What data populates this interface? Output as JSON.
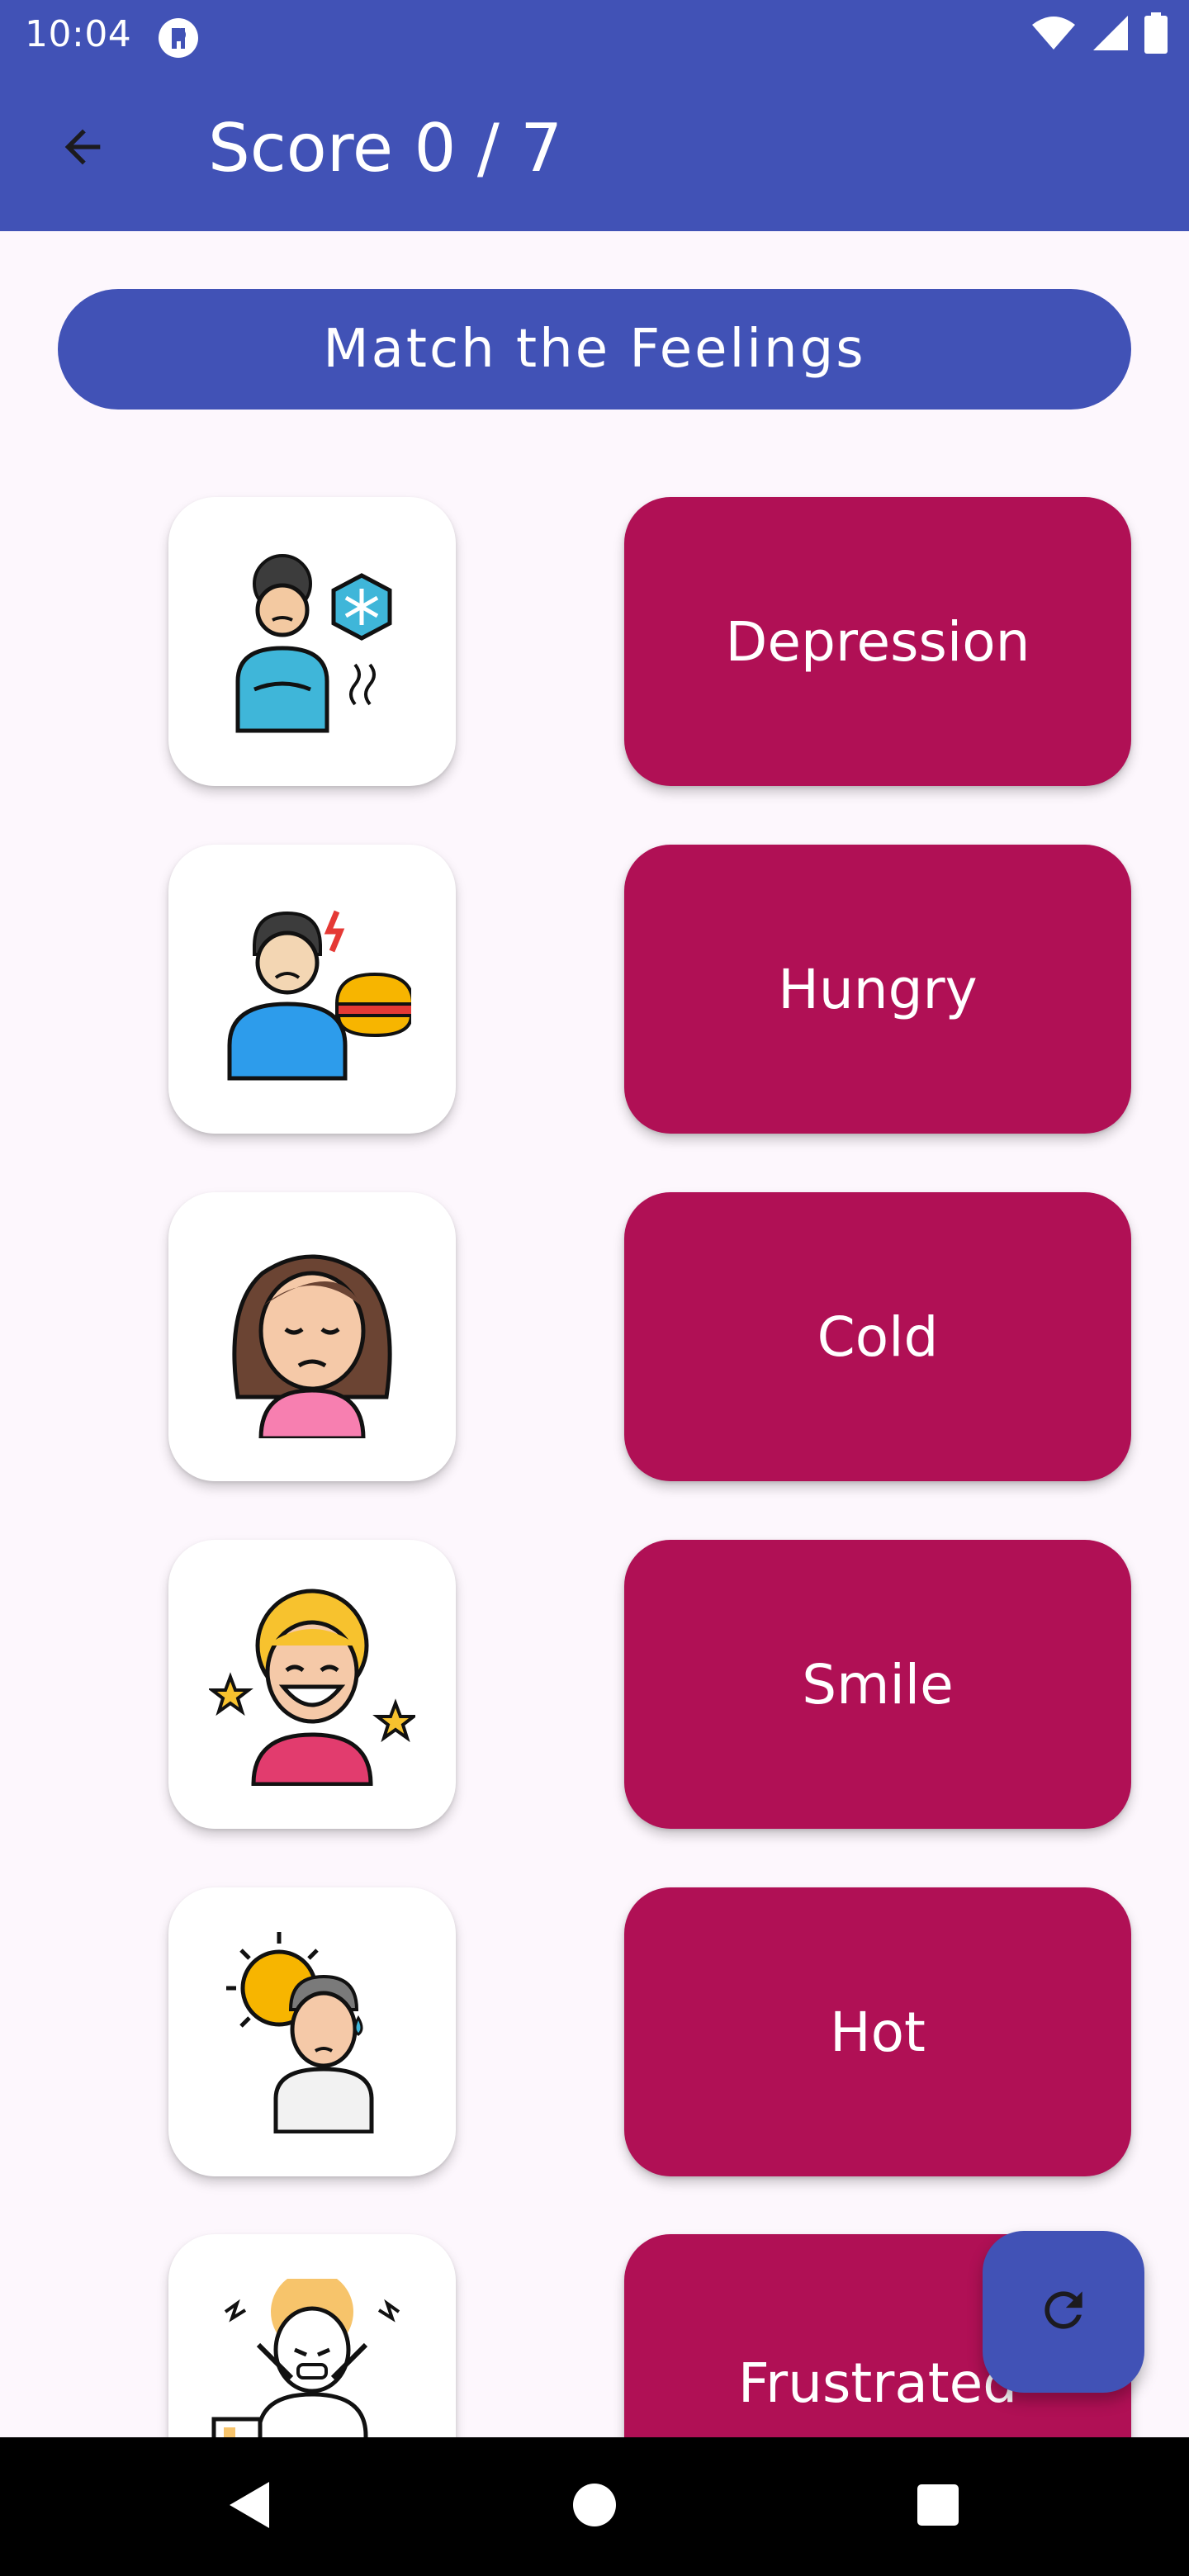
{
  "status_bar": {
    "time": "10:04",
    "icons": [
      "app-notification-icon",
      "wifi-icon",
      "signal-icon",
      "battery-icon"
    ]
  },
  "toolbar": {
    "back_icon": "arrow-left-icon",
    "title": "Score 0 / 7"
  },
  "game": {
    "header": "Match the Feelings",
    "images": [
      {
        "icon": "cold-person-icon"
      },
      {
        "icon": "hungry-person-icon"
      },
      {
        "icon": "sad-girl-icon"
      },
      {
        "icon": "smiling-person-icon"
      },
      {
        "icon": "hot-person-icon"
      },
      {
        "icon": "frustrated-person-icon"
      }
    ],
    "words": [
      "Depression",
      "Hungry",
      "Cold",
      "Smile",
      "Hot",
      "Frustrated"
    ]
  },
  "fab": {
    "icon": "refresh-icon"
  },
  "nav_bar": {
    "icons": [
      "back-triangle-icon",
      "home-circle-icon",
      "recents-square-icon"
    ]
  },
  "colors": {
    "primary": "#4152B6",
    "word_card": "#B01055",
    "background": "#FDF7FD"
  }
}
